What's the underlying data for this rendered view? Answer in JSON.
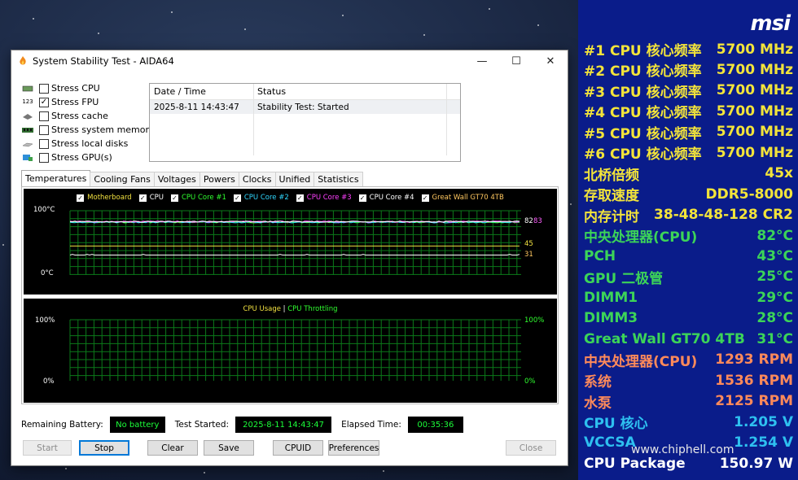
{
  "window": {
    "title": "System Stability Test - AIDA64"
  },
  "stress_options": [
    {
      "label": "Stress CPU",
      "checked": false,
      "icon": "cpu-chip-icon"
    },
    {
      "label": "Stress FPU",
      "checked": true,
      "icon": "fpu-icon"
    },
    {
      "label": "Stress cache",
      "checked": false,
      "icon": "cache-icon"
    },
    {
      "label": "Stress system memory",
      "checked": false,
      "icon": "memory-icon"
    },
    {
      "label": "Stress local disks",
      "checked": false,
      "icon": "disk-icon"
    },
    {
      "label": "Stress GPU(s)",
      "checked": false,
      "icon": "gpu-icon"
    }
  ],
  "log": {
    "headers": [
      "Date / Time",
      "Status"
    ],
    "rows": [
      {
        "time": "2025-8-11 14:43:47",
        "status": "Stability Test: Started"
      }
    ]
  },
  "tabs": [
    "Temperatures",
    "Cooling Fans",
    "Voltages",
    "Powers",
    "Clocks",
    "Unified",
    "Statistics"
  ],
  "temp_graph": {
    "legend": [
      {
        "label": "Motherboard",
        "color": "#f0e040"
      },
      {
        "label": "CPU",
        "color": "#ffffff"
      },
      {
        "label": "CPU Core #1",
        "color": "#30ff30"
      },
      {
        "label": "CPU Core #2",
        "color": "#30d8ff"
      },
      {
        "label": "CPU Core #3",
        "color": "#ff40ff"
      },
      {
        "label": "CPU Core #4",
        "color": "#ffffff"
      },
      {
        "label": "Great Wall GT70 4TB",
        "color": "#ffc860"
      }
    ],
    "y_max_label": "100°C",
    "y_min_label": "0°C",
    "right_labels": [
      "82",
      "83",
      "45",
      "31"
    ],
    "series_values": {
      "cpu_cores": 82,
      "cpu": 83,
      "motherboard": 45,
      "ssd": 31
    }
  },
  "usage_graph": {
    "legend_usage": "CPU Usage",
    "legend_sep": "|",
    "legend_throttle": "CPU Throttling",
    "y_max_label": "100%",
    "y_min_label": "0%",
    "right_max_label": "100%",
    "right_min_label": "0%"
  },
  "status_bar": {
    "battery_label": "Remaining Battery:",
    "battery_value": "No battery",
    "started_label": "Test Started:",
    "started_value": "2025-8-11 14:43:47",
    "elapsed_label": "Elapsed Time:",
    "elapsed_value": "00:35:36"
  },
  "buttons": {
    "start": "Start",
    "stop": "Stop",
    "clear": "Clear",
    "save": "Save",
    "cpuid": "CPUID",
    "preferences": "Preferences",
    "close": "Close"
  },
  "osd": {
    "logo": "msi",
    "rows": [
      {
        "label": "#1 CPU 核心频率",
        "value": "5700 MHz",
        "color": "y"
      },
      {
        "label": "#2 CPU 核心频率",
        "value": "5700 MHz",
        "color": "y"
      },
      {
        "label": "#3 CPU 核心频率",
        "value": "5700 MHz",
        "color": "y"
      },
      {
        "label": "#4 CPU 核心频率",
        "value": "5700 MHz",
        "color": "y"
      },
      {
        "label": "#5 CPU 核心频率",
        "value": "5700 MHz",
        "color": "y"
      },
      {
        "label": "#6 CPU 核心频率",
        "value": "5700 MHz",
        "color": "y"
      },
      {
        "label": "北桥倍频",
        "value": "45x",
        "color": "y"
      },
      {
        "label": "存取速度",
        "value": "DDR5-8000",
        "color": "y"
      },
      {
        "label": "内存计时",
        "value": "38-48-48-128 CR2",
        "color": "y"
      },
      {
        "label": "中央处理器(CPU)",
        "value": "82°C",
        "color": "g"
      },
      {
        "label": "PCH",
        "value": "43°C",
        "color": "g"
      },
      {
        "label": "GPU 二极管",
        "value": "25°C",
        "color": "g"
      },
      {
        "label": "DIMM1",
        "value": "29°C",
        "color": "g"
      },
      {
        "label": "DIMM3",
        "value": "28°C",
        "color": "g"
      },
      {
        "label": "Great Wall GT70 4TB",
        "value": "31°C",
        "color": "g"
      },
      {
        "label": "中央处理器(CPU)",
        "value": "1293 RPM",
        "color": "o"
      },
      {
        "label": "系统",
        "value": "1536 RPM",
        "color": "o"
      },
      {
        "label": "水泵",
        "value": "2125 RPM",
        "color": "o"
      },
      {
        "label": "CPU 核心",
        "value": "1.205 V",
        "color": "c"
      },
      {
        "label": "VCCSA",
        "value": "1.254 V",
        "color": "c"
      },
      {
        "label": "CPU Package",
        "value": "150.97 W",
        "color": "w"
      }
    ]
  },
  "watermark": "www.chiphell.com"
}
